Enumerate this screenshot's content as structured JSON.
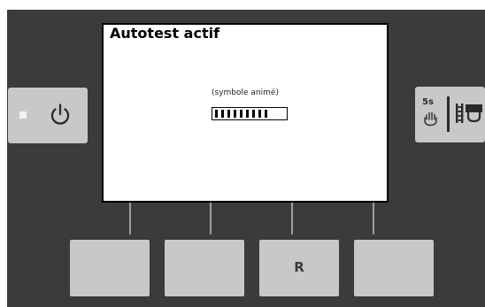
{
  "screen": {
    "title": "Autotest actif",
    "status_text": "(symbole animé)",
    "progress_segments_filled": 9,
    "progress_fraction": 0.75
  },
  "side_buttons": {
    "left": {
      "indicator": "led-indicator",
      "icon": "power-icon"
    },
    "right": {
      "timer_label": "5s",
      "icons": [
        "hand-hold-icon",
        "plug-icon"
      ]
    }
  },
  "bottom_buttons": [
    {
      "label": ""
    },
    {
      "label": ""
    },
    {
      "label": "R"
    },
    {
      "label": ""
    }
  ],
  "colors": {
    "panel": "#3b3b3b",
    "button": "#c8c8c8",
    "screen": "#ffffff",
    "icon": "#2b2b2b"
  }
}
